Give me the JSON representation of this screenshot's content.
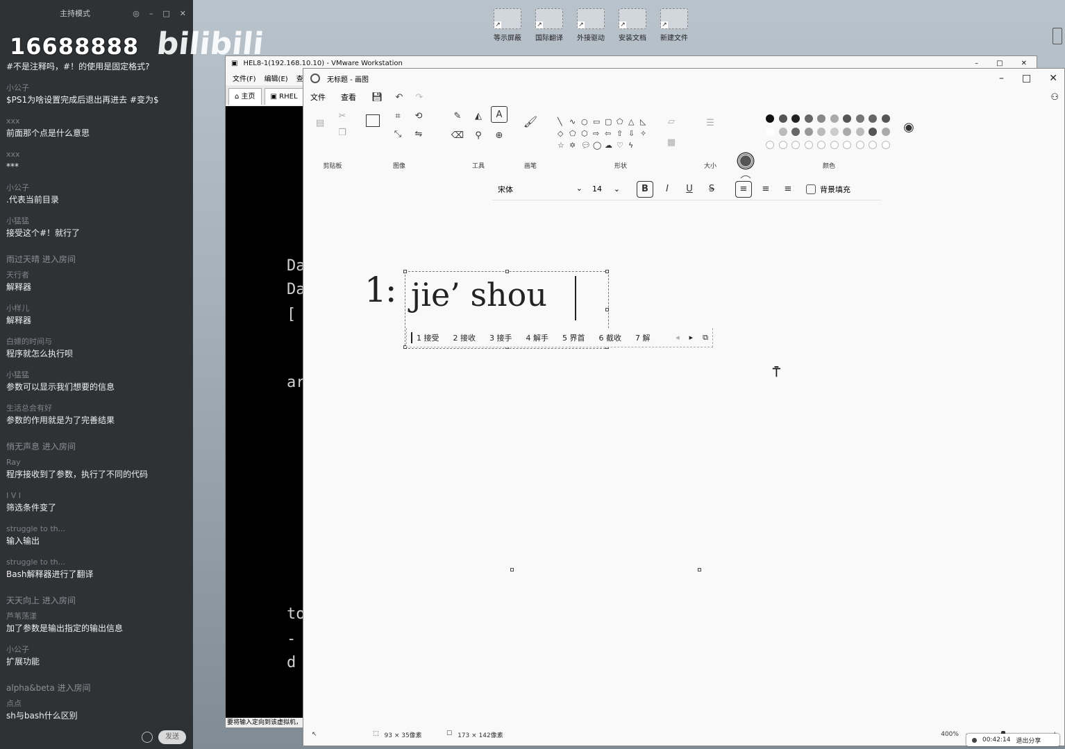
{
  "desktop": {
    "icons": [
      "等示屏蔽",
      "国际翻译",
      "外接驱动",
      "安装文档",
      "新建文件"
    ]
  },
  "chat": {
    "header": {
      "mode": "主持模式"
    },
    "overlay": {
      "number": "16688888",
      "logo": "bilibili"
    },
    "messages": [
      {
        "user": "",
        "text": "#不是注释吗，#！的使用是固定格式?",
        "entry": false
      },
      {
        "user": "小公子",
        "text": "$PS1为啥设置完成后退出再进去 #变为$",
        "entry": false
      },
      {
        "user": "xxx",
        "text": "前面那个点是什么意思",
        "entry": false
      },
      {
        "user": "xxx",
        "text": "***",
        "entry": false
      },
      {
        "user": "小公子",
        "text": ".代表当前目录",
        "entry": false
      },
      {
        "user": "小猛猛",
        "text": "接受这个#！就行了",
        "entry": false
      },
      {
        "user": "",
        "text": "雨过天晴 进入房间",
        "entry": true
      },
      {
        "user": "天行者",
        "text": "解释器",
        "entry": false
      },
      {
        "user": "小样儿",
        "text": "解释器",
        "entry": false
      },
      {
        "user": "白嫖的时间与",
        "text": "程序就怎么执行呗",
        "entry": false
      },
      {
        "user": "小猛猛",
        "text": "参数可以显示我们想要的信息",
        "entry": false
      },
      {
        "user": "生活总会有好",
        "text": "参数的作用就是为了完善结果",
        "entry": false
      },
      {
        "user": "",
        "text": "悄无声息 进入房间",
        "entry": true
      },
      {
        "user": "Ray",
        "text": "程序接收到了参数，执行了不同的代码",
        "entry": false
      },
      {
        "user": "I  V  I",
        "text": "筛选条件变了",
        "entry": false
      },
      {
        "user": "struggle to th...",
        "text": "输入输出",
        "entry": false
      },
      {
        "user": "struggle to th...",
        "text": "Bash解释器进行了翻译",
        "entry": false
      },
      {
        "user": "",
        "text": "天天向上 进入房间",
        "entry": true
      },
      {
        "user": "芦苇荡漾",
        "text": "加了参数是输出指定的输出信息",
        "entry": false
      },
      {
        "user": "小公子",
        "text": "扩展功能",
        "entry": false
      },
      {
        "user": "",
        "text": "alpha&beta 进入房间",
        "entry": true
      },
      {
        "user": "点点",
        "text": "sh与bash什么区别",
        "entry": false
      }
    ],
    "send_label": "发送"
  },
  "vmware": {
    "title": "HEL8-1(192.168.10.10) - VMware Workstation",
    "menu": [
      "文件(F)",
      "编辑(E)",
      "查看"
    ],
    "tabs": [
      "主页",
      "RHEL"
    ],
    "term_lines": [
      "Da",
      "Da",
      "[",
      "ar",
      "to",
      "-",
      "d"
    ],
    "status": "要将输入定向到该虚拟机，"
  },
  "paint": {
    "title": "无标题 - 画图",
    "menu": {
      "file": "文件",
      "view": "查看"
    },
    "groups": {
      "clipboard": "剪贴板",
      "image": "图像",
      "tools": "工具",
      "brushes": "画笔",
      "shapes": "形状",
      "size": "大小",
      "colors": "颜色"
    },
    "textbar": {
      "font": "宋体",
      "size": "14",
      "bg_fill": "背景填充"
    },
    "canvas": {
      "line_label": "1:",
      "text": "jie’ shou",
      "candidates": [
        "1 接受",
        "2 接收",
        "3 接手",
        "4 解手",
        "5 界首",
        "6 截收",
        "7 解"
      ]
    },
    "status": {
      "selection": "93 × 35像素",
      "canvas_size": "173 × 142像素",
      "zoom": "400%"
    },
    "zoom_level": 0.4,
    "palette_row1": [
      "#111111",
      "#555555",
      "#222222",
      "#666666",
      "#888888",
      "#aaaaaa",
      "#555555",
      "#777777",
      "#666666",
      "#555555"
    ],
    "palette_row2": [
      "#ffffff",
      "#bbbbbb",
      "#666666",
      "#999999",
      "#bbbbbb",
      "#cccccc",
      "#aaaaaa",
      "#bbbbbb",
      "#555555",
      "#aaaaaa"
    ]
  },
  "sharebar": {
    "time": "00:42:14",
    "exit": "退出分享"
  }
}
